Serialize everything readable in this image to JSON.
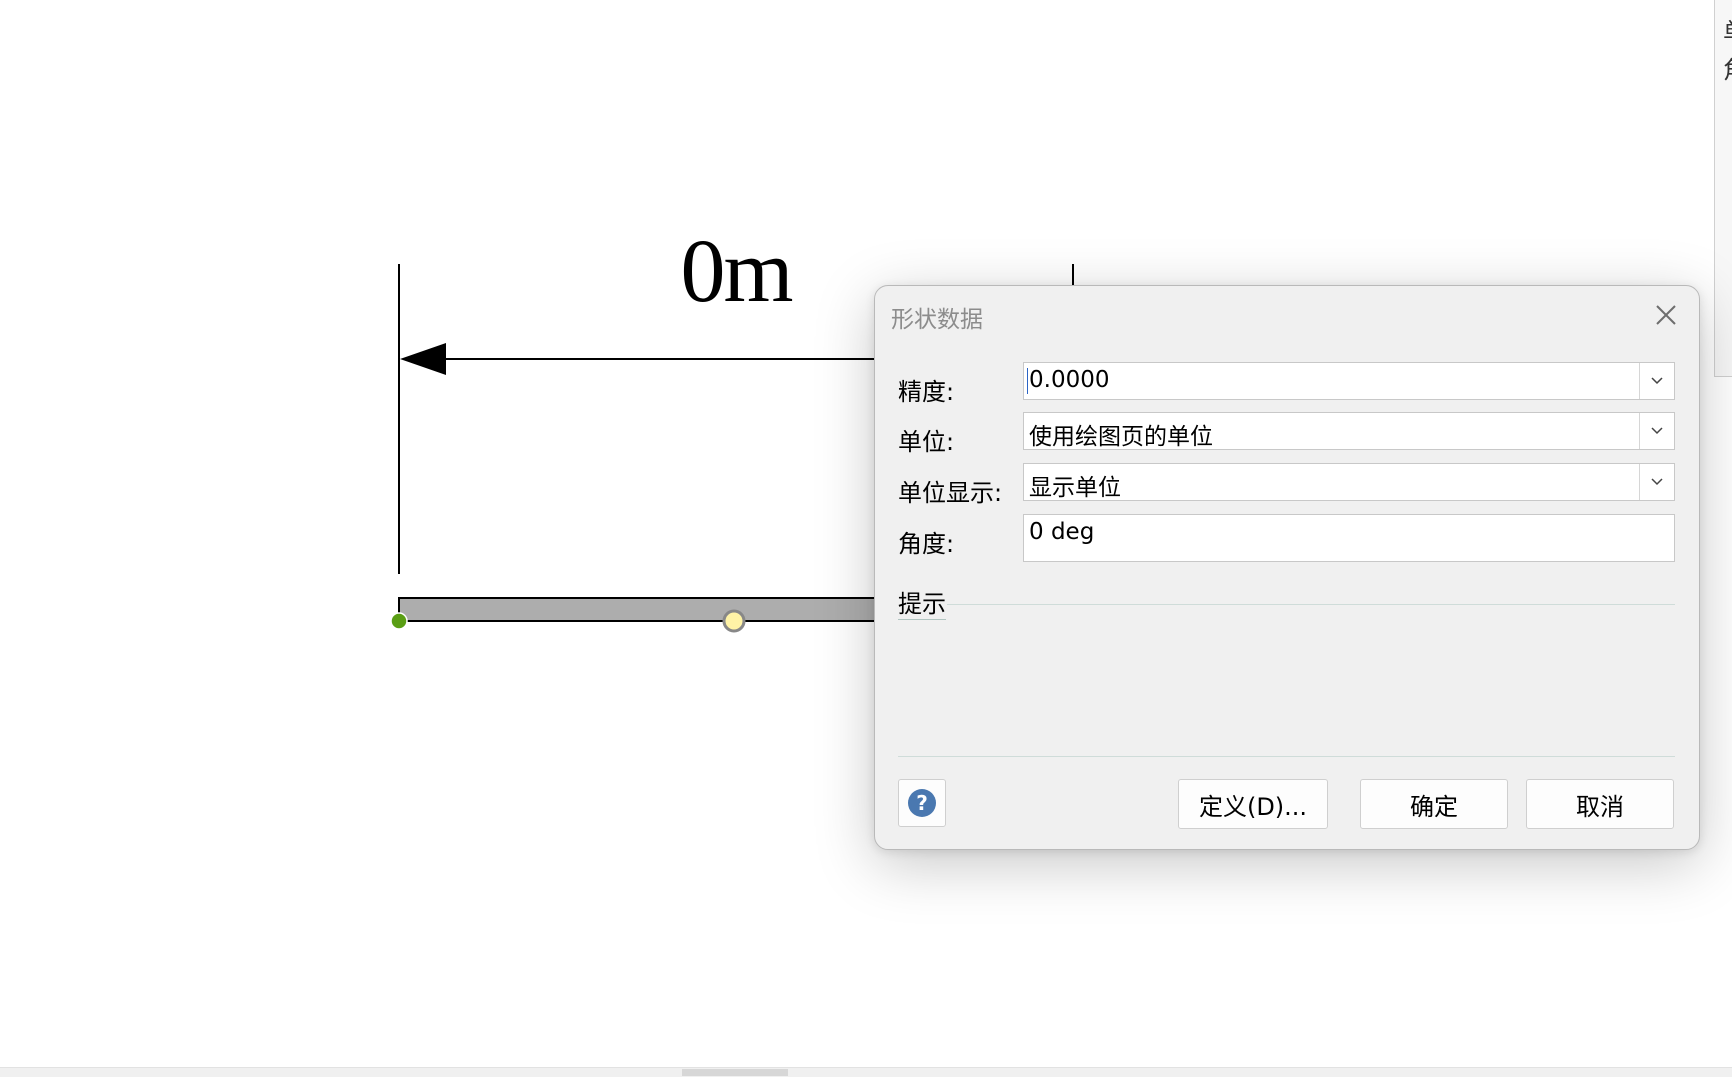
{
  "canvas": {
    "dimension_label": "0m"
  },
  "right_panel": {
    "glyph_1": "单",
    "glyph_2": "角"
  },
  "dialog": {
    "title": "形状数据",
    "close_icon": "close-icon",
    "fields": [
      {
        "label": "精度:",
        "value": "0.0000",
        "kind": "combo"
      },
      {
        "label": "单位:",
        "value": "使用绘图页的单位",
        "kind": "combo"
      },
      {
        "label": "单位显示:",
        "value": "显示单位",
        "kind": "combo"
      },
      {
        "label": "角度:",
        "value": "0 deg",
        "kind": "text"
      }
    ],
    "hint_label": "提示",
    "help_icon": "help-icon",
    "buttons": {
      "define": "定义(D)...",
      "ok": "确定",
      "cancel": "取消"
    }
  },
  "colors": {
    "dialog_bg": "#f0f0f0",
    "help_blue": "#4a78b0",
    "handle_green": "#5a9e14",
    "handle_yellow": "#fff3a6",
    "bar_gray": "#adadad"
  }
}
